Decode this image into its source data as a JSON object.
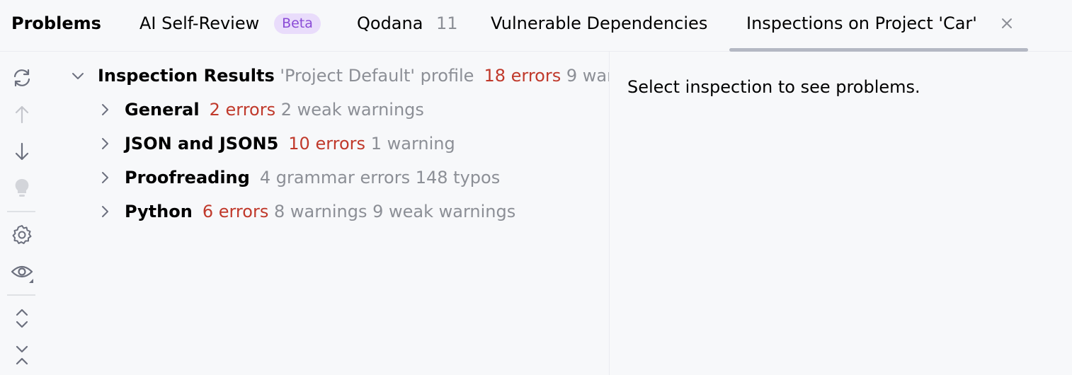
{
  "tabs": {
    "problems": "Problems",
    "ai_self_review": "AI Self-Review",
    "beta_badge": "Beta",
    "qodana": "Qodana",
    "qodana_count": "11",
    "vulnerable_dependencies": "Vulnerable Dependencies",
    "inspections": "Inspections on Project 'Car'"
  },
  "toolbar": {
    "icons": [
      "refresh-icon",
      "arrow-up-icon",
      "arrow-down-icon",
      "lightbulb-icon",
      "gear-icon",
      "eye-icon",
      "expand-all-icon",
      "collapse-all-icon"
    ]
  },
  "tree": {
    "root": {
      "label": "Inspection Results",
      "profile": "'Project Default' profile",
      "errors": "18 errors",
      "warnings": "9 war"
    },
    "items": [
      {
        "label": "General",
        "errors": "2 errors",
        "rest": "2 weak warnings"
      },
      {
        "label": "JSON and JSON5",
        "errors": "10 errors",
        "rest": "1 warning"
      },
      {
        "label": "Proofreading",
        "errors": "",
        "rest": "4 grammar errors 148 typos"
      },
      {
        "label": "Python",
        "errors": "6 errors",
        "rest": "8 warnings 9 weak warnings"
      }
    ]
  },
  "detail": {
    "message": "Select inspection to see problems."
  },
  "colors": {
    "background": "#f7f8fa",
    "error": "#c0392b",
    "muted": "#8c8f96",
    "beta_bg": "#e9dcfb",
    "beta_fg": "#8a4bd6",
    "active_tab_underline": "#b4b8c3"
  }
}
